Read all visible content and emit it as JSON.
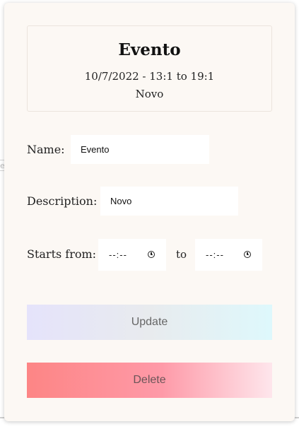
{
  "event": {
    "title": "Evento",
    "dates": "10/7/2022 - 13:1 to 19:1",
    "description": "Novo"
  },
  "form": {
    "name_label": "Name:",
    "name_value": "Evento",
    "description_label": "Description:",
    "description_value": "Novo",
    "starts_label": "Starts from:",
    "start_time_placeholder": "--:--",
    "to_label": "to",
    "end_time_placeholder": "--:--"
  },
  "buttons": {
    "update_label": "Update",
    "delete_label": "Delete"
  },
  "icons": {
    "start_time_icon": "clock-icon",
    "end_time_icon": "clock-icon"
  },
  "colors": {
    "modal_background": "#fcf8f4",
    "update_gradient": [
      "#e5e3fb",
      "#def8fc"
    ],
    "delete_gradient": [
      "#fd8585",
      "#fee6ec"
    ]
  }
}
